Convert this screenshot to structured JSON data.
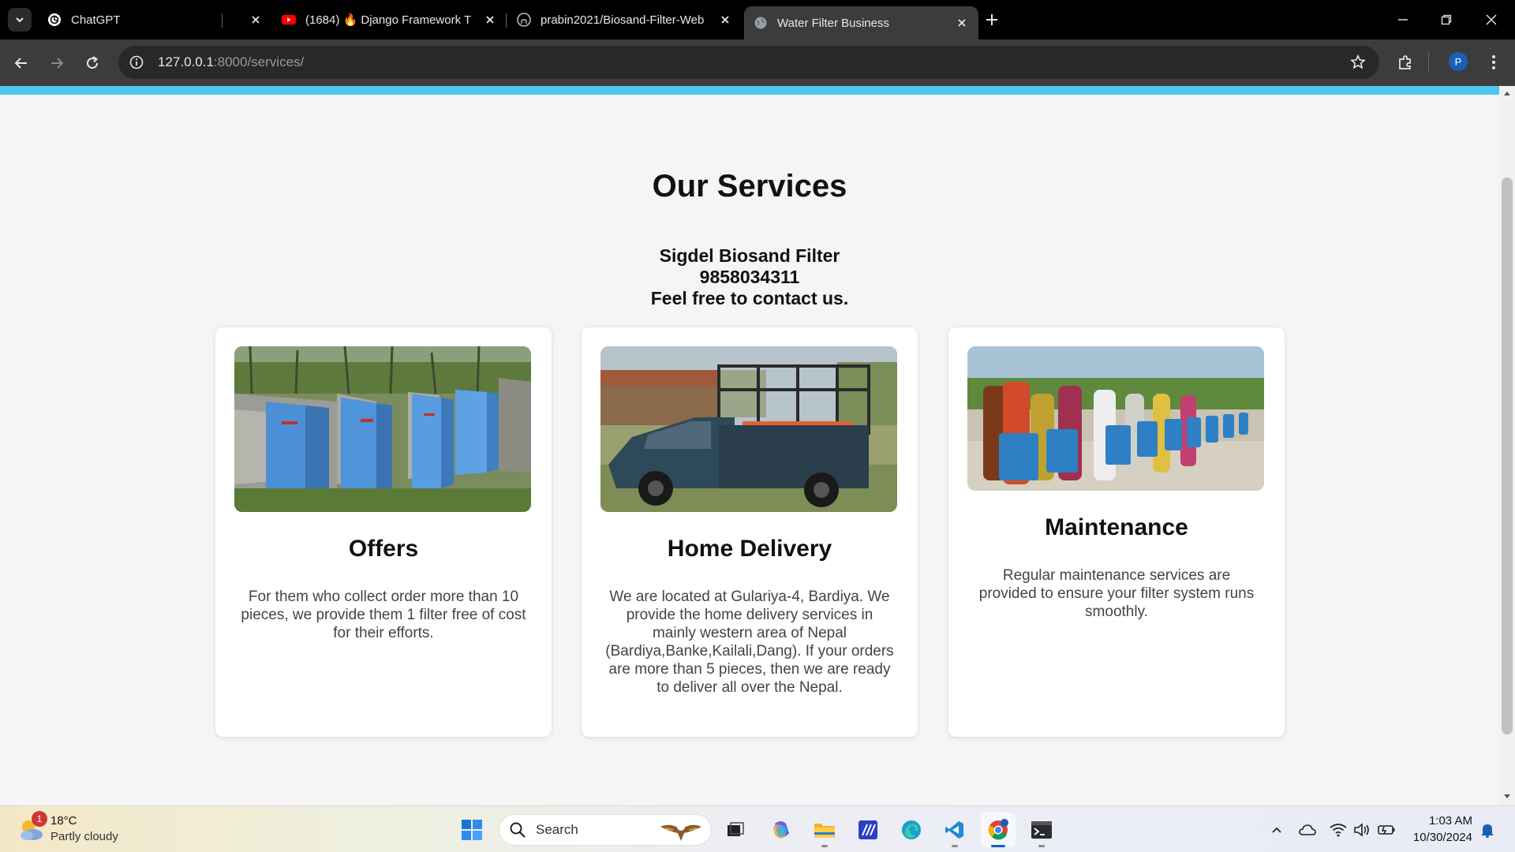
{
  "browser": {
    "tabs": [
      {
        "title": "ChatGPT",
        "icon": "chatgpt-icon"
      },
      {
        "title": "(1684) 🔥 Django Framework T",
        "icon": "youtube-icon"
      },
      {
        "title": "prabin2021/Biosand-Filter-Web",
        "icon": "github-icon"
      },
      {
        "title": "Water Filter Business",
        "icon": "globe-icon",
        "active": true
      }
    ],
    "url_host": "127.0.0.1",
    "url_path": ":8000/services/",
    "profile_initial": "P"
  },
  "page": {
    "heading": "Our Services",
    "contact": {
      "business_name": "Sigdel Biosand Filter",
      "phone": "9858034311",
      "tagline": "Feel free to contact us."
    },
    "services": [
      {
        "title": "Offers",
        "description": "For them who collect order more than 10 pieces, we provide them 1 filter free of cost for their efforts."
      },
      {
        "title": "Home Delivery",
        "description": "We are located at Gulariya-4, Bardiya. We provide the home delivery services in mainly western area of Nepal (Bardiya,Banke,Kailali,Dang). If your orders are more than 5 pieces, then we are ready to deliver all over the Nepal."
      },
      {
        "title": "Maintenance",
        "description": "Regular maintenance services are provided to ensure your filter system runs smoothly."
      }
    ],
    "accent_color": "#4fc7ea"
  },
  "taskbar": {
    "weather_badge": "1",
    "temperature": "18°C",
    "condition": "Partly cloudy",
    "search_label": "Search",
    "time": "1:03 AM",
    "date": "10/30/2024"
  }
}
